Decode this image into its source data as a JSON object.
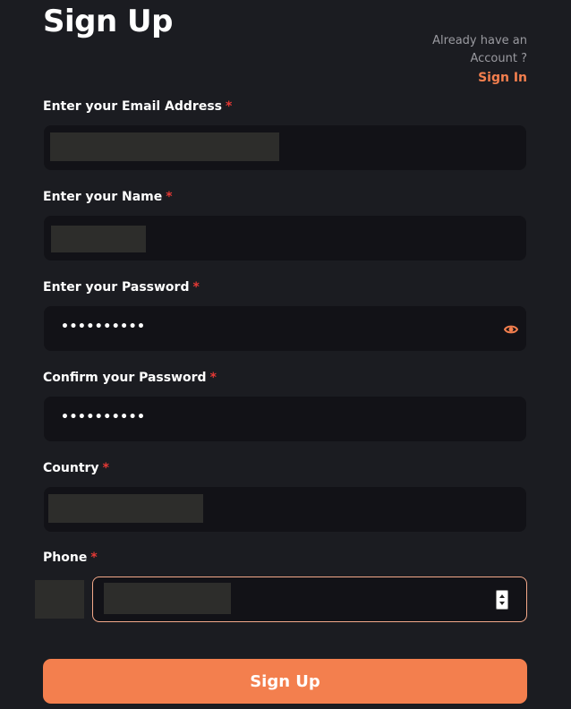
{
  "header": {
    "title": "Sign Up",
    "signin_prompt_line1": "Already have an",
    "signin_prompt_line2": "Account ?",
    "signin_link": "Sign In"
  },
  "form": {
    "required_marker": "*",
    "email": {
      "label": "Enter your Email Address"
    },
    "name": {
      "label": "Enter your Name"
    },
    "password": {
      "label": "Enter your Password",
      "value": "••••••••••",
      "toggle_icon": "eye-icon"
    },
    "confirm_password": {
      "label": "Confirm your Password",
      "value": "••••••••••"
    },
    "country": {
      "label": "Country"
    },
    "phone": {
      "label": "Phone"
    },
    "submit_label": "Sign Up"
  },
  "colors": {
    "background": "#1b1c21",
    "field_background": "#121217",
    "accent": "#f37f4e",
    "required": "#e53935"
  }
}
